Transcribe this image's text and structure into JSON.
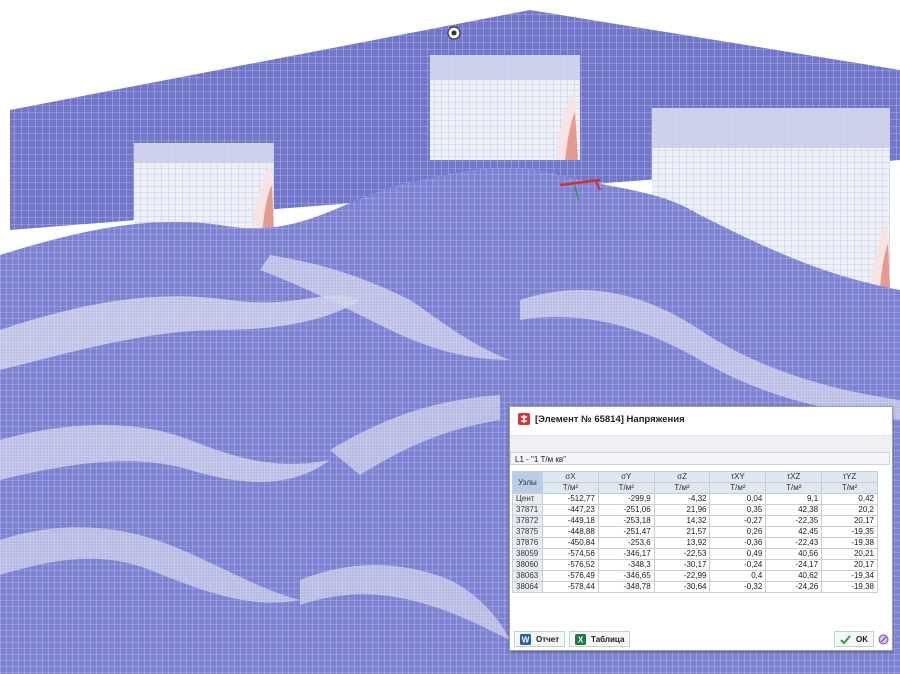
{
  "dialog": {
    "title": "[Элемент № 65814] Напряжения",
    "load_case": "L1 - \"1 Т/м кв\"",
    "columns": [
      {
        "name": "σX",
        "unit": "Т/м²"
      },
      {
        "name": "σY",
        "unit": "Т/м²"
      },
      {
        "name": "σZ",
        "unit": "Т/м²"
      },
      {
        "name": "τXY",
        "unit": "Т/м²"
      },
      {
        "name": "τXZ",
        "unit": "Т/м²"
      },
      {
        "name": "τYZ",
        "unit": "Т/м²"
      }
    ],
    "nodes_header": "Узлы",
    "rows": [
      {
        "node": "Цент",
        "values": [
          "-512,77",
          "-299,9",
          "-4,32",
          "0,04",
          "9,1",
          "0,42"
        ]
      },
      {
        "node": "37871",
        "values": [
          "-447,23",
          "-251,06",
          "21,96",
          "0,35",
          "42,38",
          "20,2"
        ]
      },
      {
        "node": "37872",
        "values": [
          "-449,18",
          "-253,18",
          "14,32",
          "-0,27",
          "-22,35",
          "20,17"
        ]
      },
      {
        "node": "37875",
        "values": [
          "-448,88",
          "-251,47",
          "21,57",
          "0,26",
          "42,45",
          "-19,35"
        ]
      },
      {
        "node": "37876",
        "values": [
          "-450,84",
          "-253,6",
          "13,92",
          "-0,36",
          "-22,43",
          "-19,38"
        ]
      },
      {
        "node": "38059",
        "values": [
          "-574,56",
          "-346,17",
          "-22,53",
          "0,49",
          "40,56",
          "20,21"
        ]
      },
      {
        "node": "38060",
        "values": [
          "-576,52",
          "-348,3",
          "-30,17",
          "-0,24",
          "-24,17",
          "20,17"
        ]
      },
      {
        "node": "38063",
        "values": [
          "-576,49",
          "-346,65",
          "-22,99",
          "0,4",
          "40,62",
          "-19,34"
        ]
      },
      {
        "node": "38064",
        "values": [
          "-578,44",
          "-348,78",
          "-30,64",
          "-0,32",
          "-24,26",
          "-19,38"
        ]
      }
    ],
    "buttons": {
      "report": "Отчет",
      "table": "Таблица",
      "ok": "OK"
    }
  },
  "colors": {
    "mesh_fill": "#7d82d2",
    "mesh_line": "#d9dbf2",
    "wall_fill": "#6f74c9",
    "stress_highlight": "#f2f2f6"
  },
  "icons": [
    "gizmo-icon",
    "app-logo-icon",
    "word-icon",
    "excel-icon",
    "check-icon",
    "help-icon"
  ]
}
